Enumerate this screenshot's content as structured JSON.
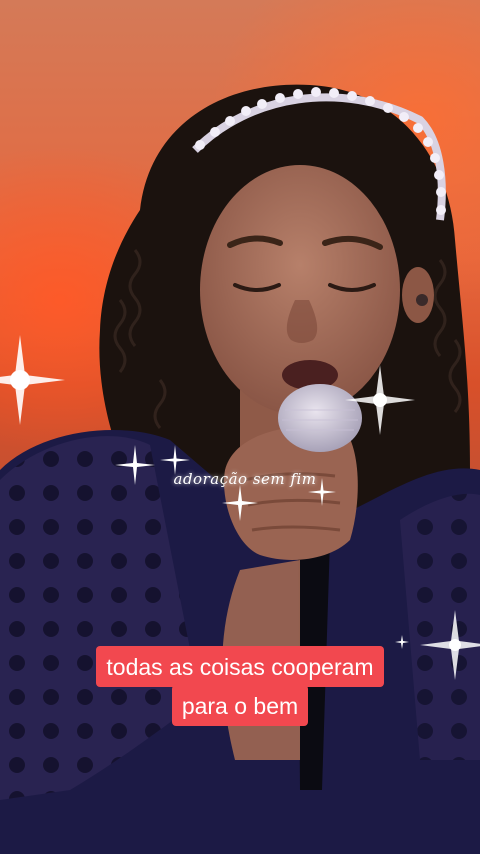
{
  "video": {
    "watermark": "adoração sem fim",
    "caption": {
      "line1": "todas as coisas cooperam",
      "line2": "para o bem"
    }
  },
  "colors": {
    "caption_bg": "#f2484f",
    "caption_text": "#ffffff",
    "background_orange": "#e6673d",
    "dress_navy": "#1c1a45"
  }
}
